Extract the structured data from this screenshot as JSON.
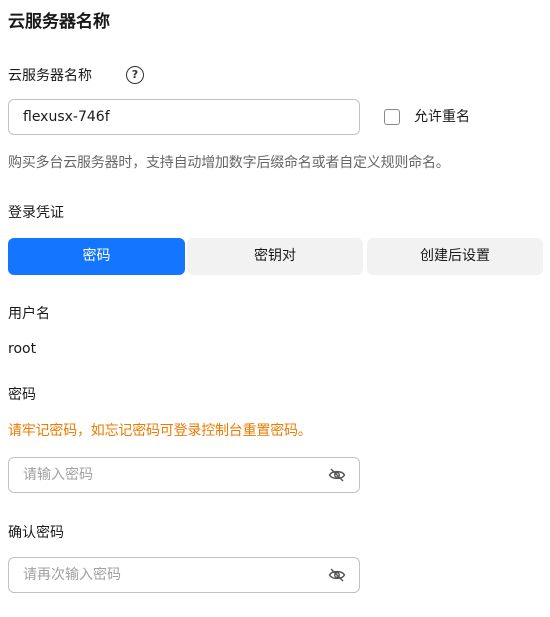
{
  "server_name_section": {
    "title": "云服务器名称",
    "field_label": "云服务器名称",
    "help_glyph": "?",
    "name_value": "flexusx-746f",
    "allow_duplicate_label": "允许重名",
    "allow_duplicate_checked": false,
    "hint": "购买多台云服务器时，支持自动增加数字后缀命名或者自定义规则命名。"
  },
  "login_section": {
    "label": "登录凭证",
    "tabs": [
      {
        "label": "密码",
        "active": true
      },
      {
        "label": "密钥对",
        "active": false
      },
      {
        "label": "创建后设置",
        "active": false
      }
    ],
    "username_label": "用户名",
    "username_value": "root",
    "password_label": "密码",
    "password_warning": "请牢记密码，如忘记密码可登录控制台重置密码。",
    "password_placeholder": "请输入密码",
    "confirm_label": "确认密码",
    "confirm_placeholder": "请再次输入密码"
  },
  "icons": {
    "help": "question-circle-icon",
    "password_visibility": "eye-off-icon"
  },
  "colors": {
    "accent": "#1476ff",
    "warning": "#ed7a00",
    "tab_inactive": "#f2f2f2"
  }
}
